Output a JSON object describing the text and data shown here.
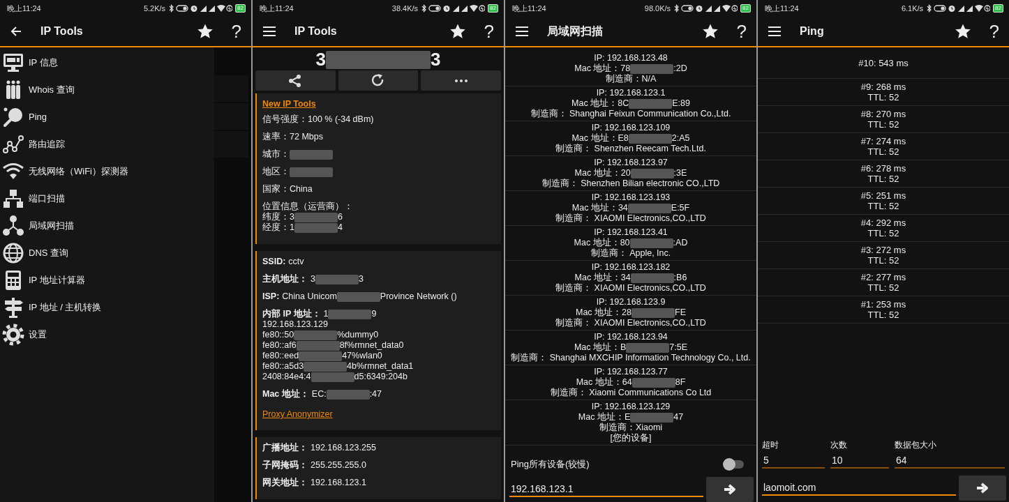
{
  "screens": [
    {
      "kind": "drawer",
      "status_bar": {
        "time": "晚上11:24",
        "speed": "5.2K/s",
        "battery": "82"
      },
      "header": {
        "nav": {
          "kind": "back"
        },
        "title": "IP Tools",
        "help": "?"
      },
      "menu_items": [
        {
          "label": "IP 信息"
        },
        {
          "label": "Whois 查询"
        },
        {
          "label": "Ping"
        },
        {
          "label": "路由追踪"
        },
        {
          "label": "无线网络（WiFi）探测器"
        },
        {
          "label": "端口扫描"
        },
        {
          "label": "局域网扫描"
        },
        {
          "label": "DNS 查询"
        },
        {
          "label": "IP 地址计算器"
        },
        {
          "label": "IP 地址 / 主机转换"
        },
        {
          "label": "设置"
        }
      ]
    },
    {
      "kind": "ip_info",
      "status_bar": {
        "time": "晚上11:24",
        "speed": "38.4K/s",
        "battery": "82"
      },
      "header": {
        "nav": {
          "kind": "menu"
        },
        "title": "IP Tools",
        "help": "?"
      },
      "public_ip": [
        "3",
        {
          "kind": "blur"
        },
        "3"
      ],
      "cards": [
        {
          "labels_bold": false,
          "items": [
            {
              "kind": "link",
              "text": "New IP Tools"
            },
            {
              "kind": "row",
              "label": "信号强度：",
              "value": [
                "100 % (-34 dBm)"
              ]
            },
            {
              "kind": "row",
              "label": "速率：",
              "value": [
                "72 Mbps"
              ]
            },
            {
              "kind": "row",
              "label": "城市：",
              "value": [
                {
                  "kind": "blur"
                }
              ]
            },
            {
              "kind": "row",
              "label": "地区：",
              "value": [
                {
                  "kind": "blur"
                }
              ]
            },
            {
              "kind": "row",
              "label": "国家：",
              "value": [
                "China"
              ]
            },
            {
              "kind": "row",
              "label": "位置信息（运营商）：",
              "value": [],
              "lines": [
                [
                  "纬度：3",
                  {
                    "kind": "blur"
                  },
                  "6"
                ],
                [
                  "经度：1",
                  {
                    "kind": "blur"
                  },
                  "4"
                ]
              ]
            }
          ]
        },
        {
          "labels_bold": true,
          "items": [
            {
              "kind": "row",
              "label": "SSID:",
              "value": [
                "cctv"
              ]
            },
            {
              "kind": "row",
              "label": "主机地址：",
              "value": [
                "3",
                {
                  "kind": "blur"
                },
                "3"
              ]
            },
            {
              "kind": "row",
              "label": "ISP:",
              "value": [
                "China Unicom",
                {
                  "kind": "blur"
                },
                "Province Network ()"
              ]
            },
            {
              "kind": "row",
              "label": "内部 IP 地址：",
              "value": [
                "1",
                {
                  "kind": "blur"
                },
                "9"
              ],
              "lines": [
                [
                  "192.168.123.129"
                ],
                [
                  "fe80::50",
                  {
                    "kind": "blur"
                  },
                  "%dummy0"
                ],
                [
                  "fe80::af6",
                  {
                    "kind": "blur"
                  },
                  "8f%rmnet_data0"
                ],
                [
                  "fe80::eed",
                  {
                    "kind": "blur"
                  },
                  "47%wlan0"
                ],
                [
                  "fe80::a5d3",
                  {
                    "kind": "blur"
                  },
                  "4b%rmnet_data1"
                ],
                [
                  "2408:84e4:4",
                  {
                    "kind": "blur"
                  },
                  "d5:6349:204b"
                ]
              ]
            },
            {
              "kind": "row",
              "label": "Mac 地址：",
              "value": [
                "EC:",
                {
                  "kind": "blur"
                },
                ":47"
              ]
            },
            {
              "kind": "link",
              "text": "Proxy Anonymizer"
            }
          ]
        },
        {
          "labels_bold": true,
          "items": [
            {
              "kind": "row",
              "label": "广播地址：",
              "value": [
                "192.168.123.255"
              ]
            },
            {
              "kind": "row",
              "label": "子网掩码：",
              "value": [
                "255.255.255.0"
              ]
            },
            {
              "kind": "row",
              "label": "网关地址：",
              "value": [
                "192.168.123.1"
              ]
            }
          ]
        }
      ]
    },
    {
      "kind": "lan_scan",
      "status_bar": {
        "time": "晚上11:24",
        "speed": "98.0K/s",
        "battery": "82"
      },
      "header": {
        "nav": {
          "kind": "menu"
        },
        "title": "局域网扫描",
        "help": "?"
      },
      "devices": [
        {
          "ip": "IP: 192.168.123.48",
          "mac_label": "Mac 地址：",
          "mac": [
            "78",
            {
              "kind": "blur"
            },
            ":2D"
          ],
          "vendor": "制造商：N/A"
        },
        {
          "ip": "IP: 192.168.123.1",
          "mac_label": "Mac 地址：",
          "mac": [
            "8C",
            {
              "kind": "blur"
            },
            "E:89"
          ],
          "vendor": "制造商： Shanghai Feixun Communication Co.,Ltd."
        },
        {
          "ip": "IP: 192.168.123.109",
          "mac_label": "Mac 地址：",
          "mac": [
            "E8",
            {
              "kind": "blur"
            },
            "2:A5"
          ],
          "vendor": "制造商： Shenzhen Reecam Tech.Ltd."
        },
        {
          "ip": "IP: 192.168.123.97",
          "mac_label": "Mac 地址：",
          "mac": [
            "20",
            {
              "kind": "blur"
            },
            ":3E"
          ],
          "vendor": "制造商： Shenzhen Bilian electronic CO.,LTD"
        },
        {
          "ip": "IP: 192.168.123.193",
          "mac_label": "Mac 地址：",
          "mac": [
            "34",
            {
              "kind": "blur"
            },
            "E:5F"
          ],
          "vendor": "制造商： XIAOMI Electronics,CO.,LTD"
        },
        {
          "ip": "IP: 192.168.123.41",
          "mac_label": "Mac 地址：",
          "mac": [
            "80",
            {
              "kind": "blur"
            },
            ":AD"
          ],
          "vendor": "制造商： Apple, Inc."
        },
        {
          "ip": "IP: 192.168.123.182",
          "mac_label": "Mac 地址：",
          "mac": [
            "34",
            {
              "kind": "blur"
            },
            ":B6"
          ],
          "vendor": "制造商： XIAOMI Electronics,CO.,LTD"
        },
        {
          "ip": "IP: 192.168.123.9",
          "mac_label": "Mac 地址：",
          "mac": [
            "28",
            {
              "kind": "blur"
            },
            "FE"
          ],
          "vendor": "制造商： XIAOMI Electronics,CO.,LTD"
        },
        {
          "ip": "IP: 192.168.123.94",
          "mac_label": "Mac 地址：",
          "mac": [
            "B",
            {
              "kind": "blur"
            },
            "7:5E"
          ],
          "vendor": "制造商： Shanghai MXCHIP Information Technology Co., Ltd."
        },
        {
          "ip": "IP: 192.168.123.77",
          "mac_label": "Mac 地址：",
          "mac": [
            "64",
            {
              "kind": "blur"
            },
            "8F"
          ],
          "vendor": "制造商： Xiaomi Communications Co Ltd"
        },
        {
          "ip": "IP: 192.168.123.129",
          "mac_label": "Mac 地址：",
          "mac": [
            "E",
            {
              "kind": "blur"
            },
            "47"
          ],
          "vendor": "制造商：Xiaomi",
          "note": "[您的设备]"
        }
      ],
      "ping_all": {
        "label": "Ping所有设备(较慢)",
        "on": false
      },
      "target": {
        "value": "192.168.123.1"
      }
    },
    {
      "kind": "ping",
      "status_bar": {
        "time": "晚上11:24",
        "speed": "6.1K/s",
        "battery": "82"
      },
      "header": {
        "nav": {
          "kind": "menu"
        },
        "title": "Ping",
        "help": "?"
      },
      "results": [
        {
          "time": "#10: 543 ms"
        },
        {
          "time": "#9: 268 ms",
          "ttl": "TTL: 52"
        },
        {
          "time": "#8: 270 ms",
          "ttl": "TTL: 52"
        },
        {
          "time": "#7: 274 ms",
          "ttl": "TTL: 52"
        },
        {
          "time": "#6: 278 ms",
          "ttl": "TTL: 52"
        },
        {
          "time": "#5: 251 ms",
          "ttl": "TTL: 52"
        },
        {
          "time": "#4: 292 ms",
          "ttl": "TTL: 52"
        },
        {
          "time": "#3: 272 ms",
          "ttl": "TTL: 52"
        },
        {
          "time": "#2: 277 ms",
          "ttl": "TTL: 52"
        },
        {
          "time": "#1: 253 ms",
          "ttl": "TTL: 52"
        }
      ],
      "fields": [
        {
          "label": "超时",
          "value": "5"
        },
        {
          "label": "次数",
          "value": "10"
        },
        {
          "label": "数据包大小",
          "value": "64"
        }
      ],
      "host": {
        "value": "laomoit.com"
      }
    }
  ]
}
